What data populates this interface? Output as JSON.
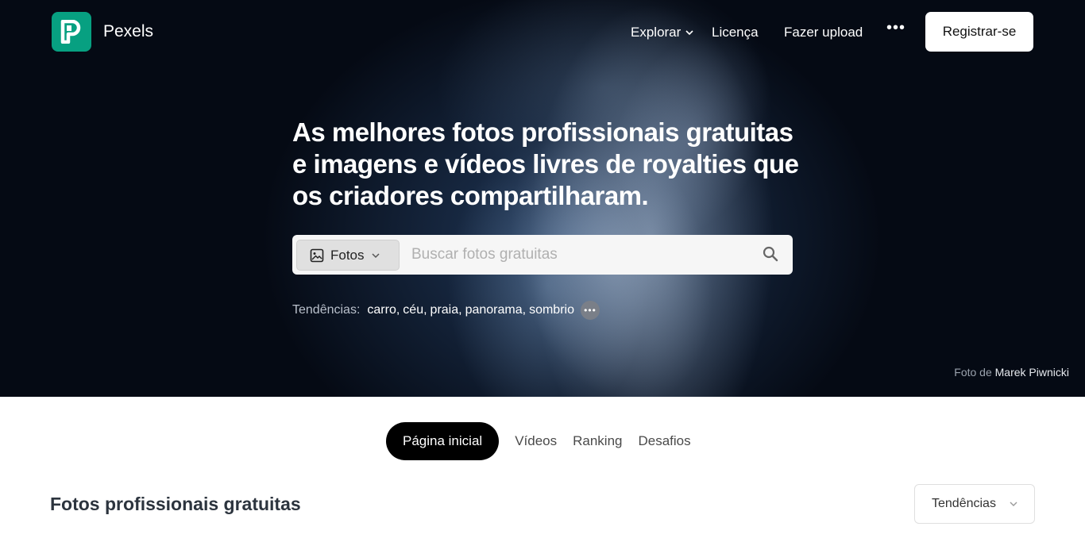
{
  "brand": {
    "name": "Pexels",
    "color": "#07a081"
  },
  "nav": {
    "explore": "Explorar",
    "license": "Licença",
    "upload": "Fazer upload",
    "more": "•••",
    "join": "Registrar-se"
  },
  "hero": {
    "headline": "As melhores fotos profissionais gratuitas e imagens e vídeos livres de royalties que os criadores compartilharam.",
    "search": {
      "type": "Fotos",
      "placeholder": "Buscar fotos gratuitas"
    },
    "trends": {
      "label": "Tendências:",
      "items": [
        "carro",
        "céu",
        "praia",
        "panorama",
        "sombrio"
      ],
      "separators": [
        ",",
        ",",
        ",",
        ","
      ],
      "more": "•••"
    },
    "credit": {
      "prefix": "Foto de",
      "author": "Marek Piwnicki"
    }
  },
  "tabs": [
    {
      "label": "Página inicial",
      "active": true
    },
    {
      "label": "Vídeos"
    },
    {
      "label": "Ranking"
    },
    {
      "label": "Desafios"
    }
  ],
  "section": {
    "title": "Fotos profissionais gratuitas",
    "sort": "Tendências"
  }
}
